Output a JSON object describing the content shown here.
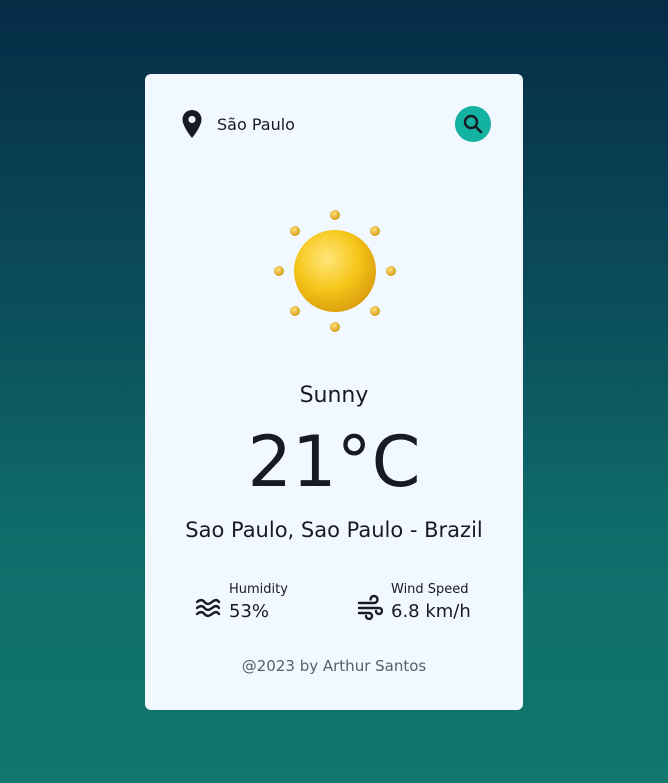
{
  "location": {
    "name": "São Paulo",
    "icon": "map-pin-icon"
  },
  "search": {
    "icon": "search-icon",
    "color": "#14b3a1"
  },
  "weather": {
    "icon": "sun-icon",
    "condition": "Sunny",
    "temperature": "21°C",
    "place": "Sao Paulo, Sao Paulo - Brazil"
  },
  "stats": {
    "humidity": {
      "label": "Humidity",
      "value": "53%",
      "icon": "water-waves-icon"
    },
    "wind": {
      "label": "Wind Speed",
      "value": "6.8 km/h",
      "icon": "wind-icon"
    }
  },
  "footer": {
    "text": "@2023 by Arthur Santos"
  },
  "colors": {
    "background_top": "#062b46",
    "background_bottom": "#11766e",
    "card": "#f2f8ff",
    "accent": "#14b3a1",
    "sun": "#f5c518"
  }
}
